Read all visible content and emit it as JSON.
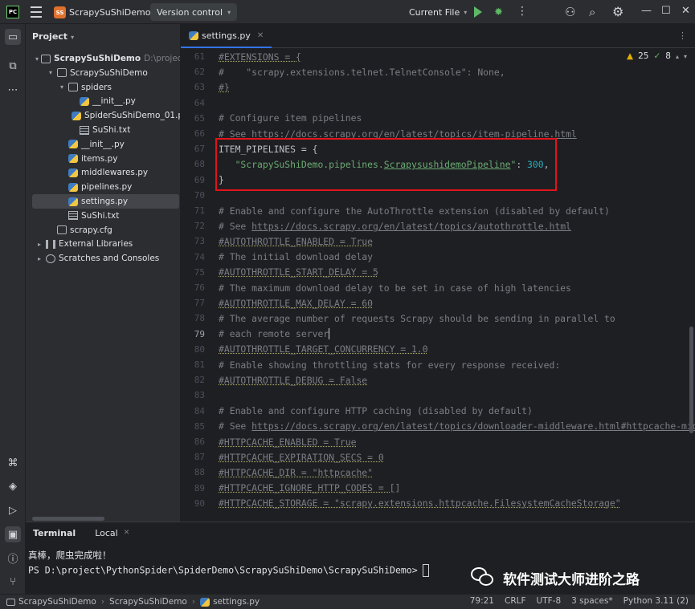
{
  "titlebar": {
    "logo_text": "PC",
    "project_badge": "SS",
    "project_name": "ScrapySuShiDemo",
    "version_control": "Version control",
    "run_config": "Current File"
  },
  "project_panel": {
    "title": "Project",
    "tree": [
      {
        "indent": 0,
        "arrow": "▾",
        "icon": "folder",
        "label": "ScrapySuShiDemo",
        "hint": "D:\\project\\Pyth",
        "bold": true
      },
      {
        "indent": 1,
        "arrow": "▾",
        "icon": "folder",
        "label": "ScrapySuShiDemo"
      },
      {
        "indent": 2,
        "arrow": "▾",
        "icon": "folder",
        "label": "spiders"
      },
      {
        "indent": 3,
        "arrow": "",
        "icon": "py",
        "label": "__init__.py"
      },
      {
        "indent": 3,
        "arrow": "",
        "icon": "py",
        "label": "SpiderSuShiDemo_01.py"
      },
      {
        "indent": 3,
        "arrow": "",
        "icon": "txt",
        "label": "SuShi.txt"
      },
      {
        "indent": 2,
        "arrow": "",
        "icon": "py",
        "label": "__init__.py"
      },
      {
        "indent": 2,
        "arrow": "",
        "icon": "py",
        "label": "items.py"
      },
      {
        "indent": 2,
        "arrow": "",
        "icon": "py",
        "label": "middlewares.py"
      },
      {
        "indent": 2,
        "arrow": "",
        "icon": "py",
        "label": "pipelines.py"
      },
      {
        "indent": 2,
        "arrow": "",
        "icon": "py",
        "label": "settings.py",
        "selected": true
      },
      {
        "indent": 2,
        "arrow": "",
        "icon": "txt",
        "label": "SuShi.txt"
      },
      {
        "indent": 1,
        "arrow": "",
        "icon": "cfg",
        "label": "scrapy.cfg"
      },
      {
        "indent": 0,
        "arrow": "▸",
        "icon": "lib",
        "label": "External Libraries"
      },
      {
        "indent": 0,
        "arrow": "▸",
        "icon": "scratch",
        "label": "Scratches and Consoles"
      }
    ]
  },
  "editor": {
    "tab_label": "settings.py",
    "warnings": "25",
    "checks": "8",
    "current_line": "79",
    "lines": [
      {
        "n": "61",
        "parts": [
          {
            "t": "#EXTENSIONS = {",
            "c": "com ul"
          }
        ]
      },
      {
        "n": "62",
        "parts": [
          {
            "t": "#    \"scrapy.extensions.telnet.TelnetConsole\": None,",
            "c": "com"
          }
        ]
      },
      {
        "n": "63",
        "parts": [
          {
            "t": "#}",
            "c": "com ul"
          }
        ]
      },
      {
        "n": "64",
        "parts": []
      },
      {
        "n": "65",
        "parts": [
          {
            "t": "# Configure item pipelines",
            "c": "com"
          }
        ]
      },
      {
        "n": "66",
        "parts": [
          {
            "t": "# See ",
            "c": "com"
          },
          {
            "t": "https://docs.scrapy.org/en/latest/topics/item-pipeline.html",
            "c": "link"
          }
        ]
      },
      {
        "n": "67",
        "parts": [
          {
            "t": "ITEM_PIPELINES = {",
            "c": "txt"
          }
        ]
      },
      {
        "n": "68",
        "parts": [
          {
            "t": "   \"ScrapySuShiDemo.pipelines.",
            "c": "str"
          },
          {
            "t": "ScrapysushidemoPipeline",
            "c": "cls"
          },
          {
            "t": "\"",
            "c": "str"
          },
          {
            "t": ": ",
            "c": "txt"
          },
          {
            "t": "300",
            "c": "num"
          },
          {
            "t": ",",
            "c": "txt"
          }
        ]
      },
      {
        "n": "69",
        "parts": [
          {
            "t": "}",
            "c": "txt"
          }
        ]
      },
      {
        "n": "70",
        "parts": []
      },
      {
        "n": "71",
        "parts": [
          {
            "t": "# Enable and configure the AutoThrottle extension (disabled by default)",
            "c": "com"
          }
        ]
      },
      {
        "n": "72",
        "parts": [
          {
            "t": "# See ",
            "c": "com"
          },
          {
            "t": "https://docs.scrapy.org/en/latest/topics/autothrottle.html",
            "c": "link"
          }
        ]
      },
      {
        "n": "73",
        "parts": [
          {
            "t": "#AUTOTHROTTLE_ENABLED = True",
            "c": "com ul"
          }
        ]
      },
      {
        "n": "74",
        "parts": [
          {
            "t": "# The initial download delay",
            "c": "com"
          }
        ]
      },
      {
        "n": "75",
        "parts": [
          {
            "t": "#AUTOTHROTTLE_START_DELAY = 5",
            "c": "com ul"
          }
        ]
      },
      {
        "n": "76",
        "parts": [
          {
            "t": "# The maximum download delay to be set in case of high latencies",
            "c": "com"
          }
        ]
      },
      {
        "n": "77",
        "parts": [
          {
            "t": "#AUTOTHROTTLE_MAX_DELAY = 60",
            "c": "com ul"
          }
        ]
      },
      {
        "n": "78",
        "parts": [
          {
            "t": "# The average number of requests Scrapy should be sending in parallel to",
            "c": "com"
          }
        ]
      },
      {
        "n": "79",
        "parts": [
          {
            "t": "# each remote server",
            "c": "com"
          }
        ],
        "caret": true
      },
      {
        "n": "80",
        "parts": [
          {
            "t": "#AUTOTHROTTLE_TARGET_CONCURRENCY = 1.0",
            "c": "com ul"
          }
        ]
      },
      {
        "n": "81",
        "parts": [
          {
            "t": "# Enable showing throttling stats for every response received:",
            "c": "com"
          }
        ]
      },
      {
        "n": "82",
        "parts": [
          {
            "t": "#AUTOTHROTTLE_DEBUG = False",
            "c": "com ul"
          }
        ]
      },
      {
        "n": "83",
        "parts": []
      },
      {
        "n": "84",
        "parts": [
          {
            "t": "# Enable and configure HTTP caching (disabled by default)",
            "c": "com"
          }
        ]
      },
      {
        "n": "85",
        "parts": [
          {
            "t": "# See ",
            "c": "com"
          },
          {
            "t": "https://docs.scrapy.org/en/latest/topics/downloader-middleware.html#httpcache-middl",
            "c": "link"
          }
        ]
      },
      {
        "n": "86",
        "parts": [
          {
            "t": "#HTTPCACHE_ENABLED = True",
            "c": "com ul"
          }
        ]
      },
      {
        "n": "87",
        "parts": [
          {
            "t": "#HTTPCACHE_EXPIRATION_SECS = 0",
            "c": "com ul"
          }
        ]
      },
      {
        "n": "88",
        "parts": [
          {
            "t": "#HTTPCACHE_DIR = \"httpcache\"",
            "c": "com ul"
          }
        ]
      },
      {
        "n": "89",
        "parts": [
          {
            "t": "#HTTPCACHE_IGNORE_HTTP_CODES = []",
            "c": "com ul"
          }
        ]
      },
      {
        "n": "90",
        "parts": [
          {
            "t": "#HTTPCACHE_STORAGE = \"scrapy.extensions.httpcache.FilesystemCacheStorage\"",
            "c": "com ul"
          }
        ]
      }
    ]
  },
  "terminal": {
    "title": "Terminal",
    "tab": "Local",
    "output": "真棒，爬虫完成啦！",
    "prompt": "PS D:\\project\\PythonSpider\\SpiderDemo\\ScrapySuShiDemo\\ScrapySuShiDemo>"
  },
  "watermark": "软件测试大师进阶之路",
  "statusbar": {
    "breadcrumbs": [
      "ScrapySuShiDemo",
      "ScrapySuShiDemo",
      "settings.py"
    ],
    "position": "79:21",
    "line_sep": "CRLF",
    "encoding": "UTF-8",
    "indent": "3 spaces*",
    "interpreter": "Python 3.11 (2)"
  },
  "colors": {
    "accent": "#3574f0",
    "highlight_box": "#e3131b",
    "run": "#5fb865"
  }
}
